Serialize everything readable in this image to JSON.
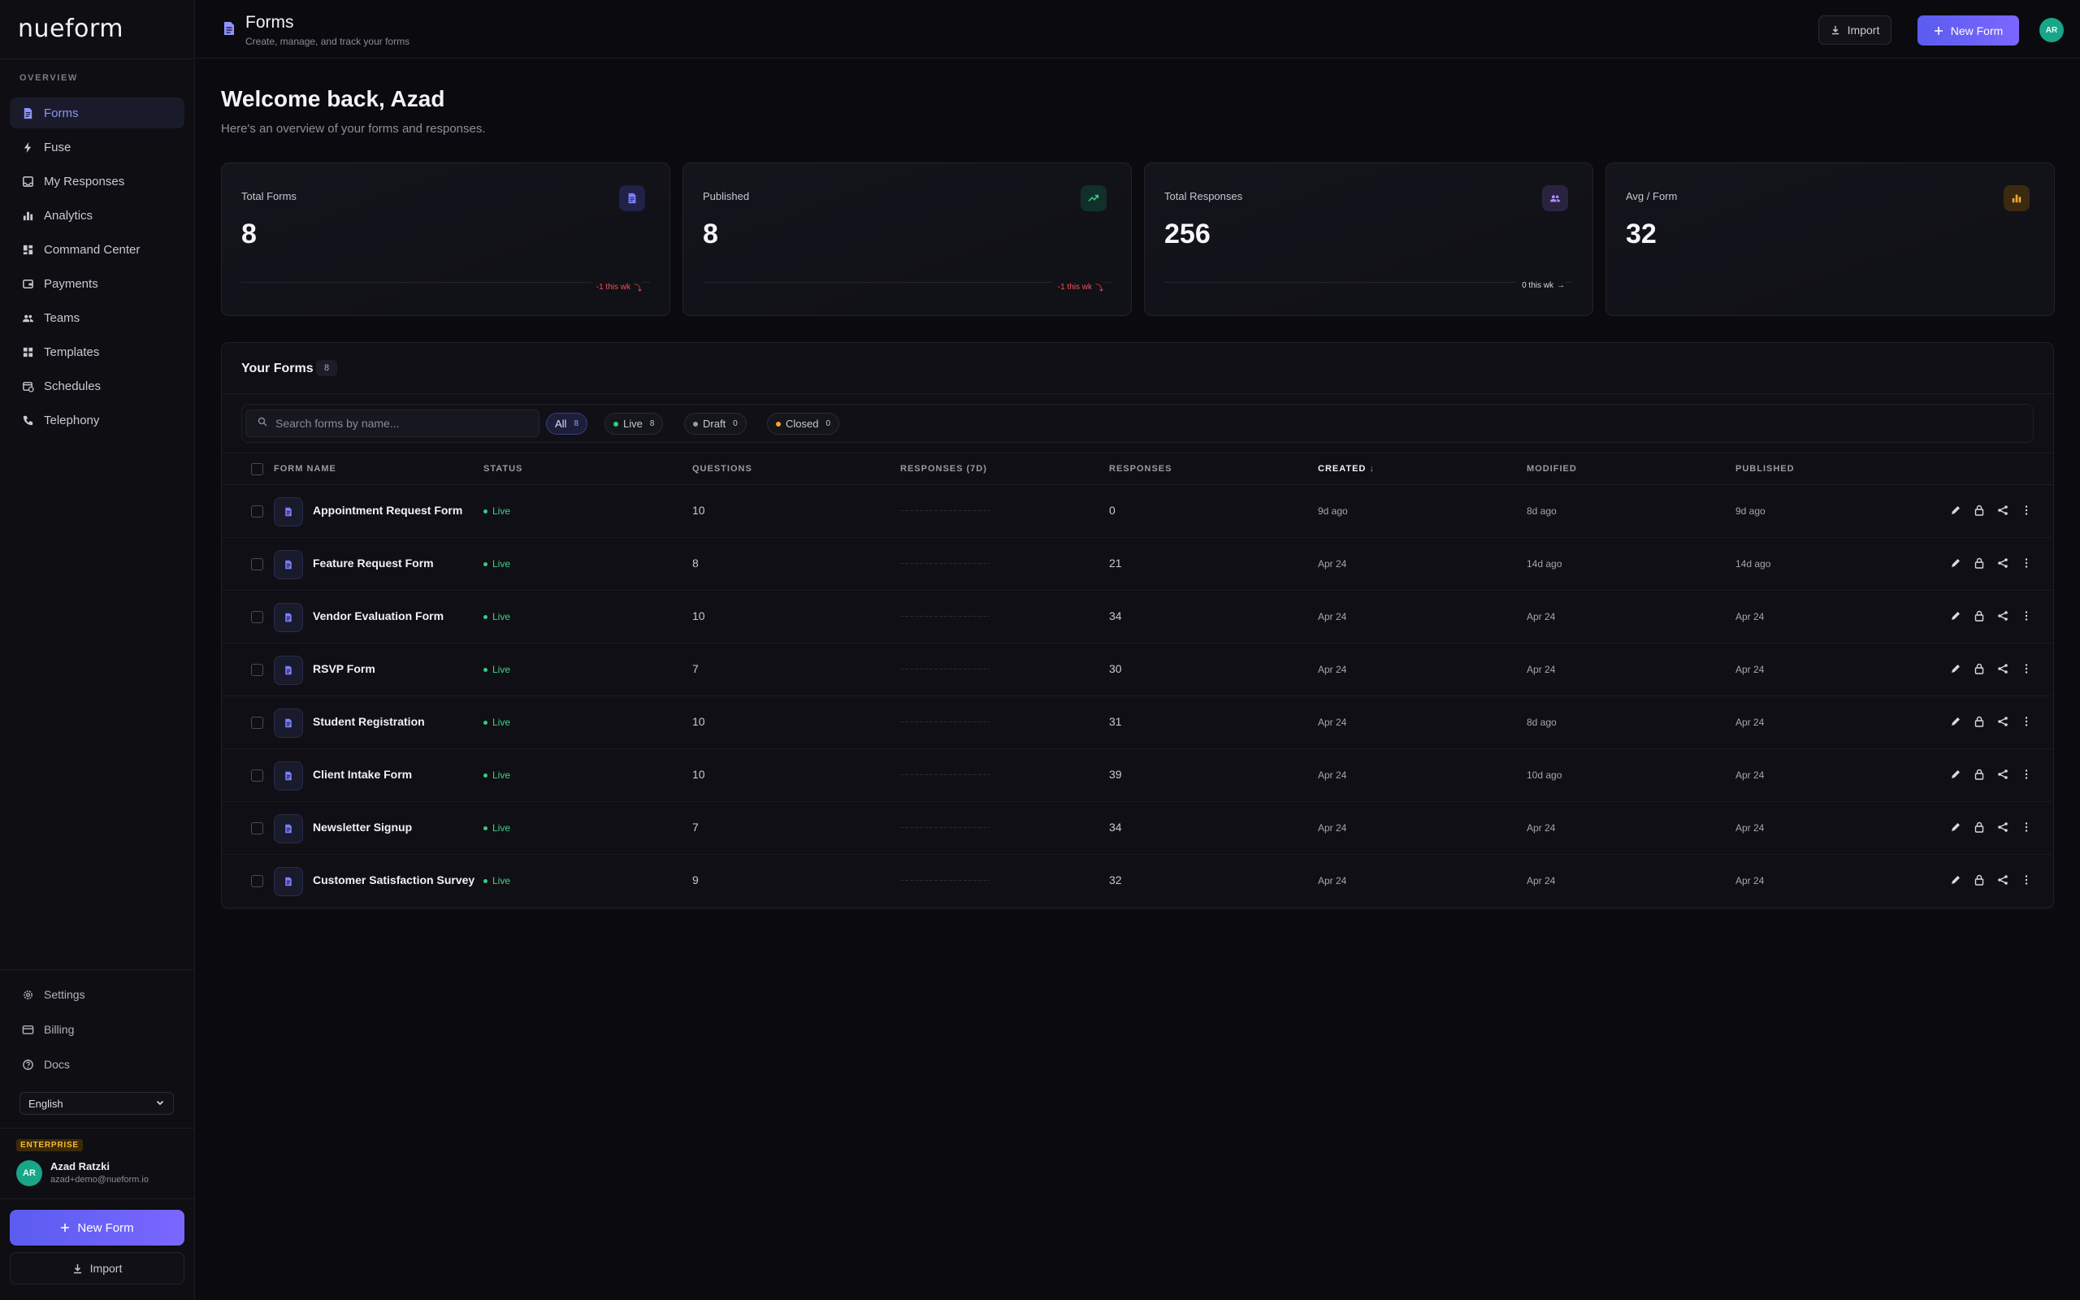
{
  "brand": {
    "logo_text": "nueform"
  },
  "sidebar": {
    "section_label": "OVERVIEW",
    "items": [
      {
        "label": "Forms",
        "icon": "document-icon",
        "active": true
      },
      {
        "label": "Fuse",
        "icon": "bolt-icon"
      },
      {
        "label": "My Responses",
        "icon": "inbox-icon"
      },
      {
        "label": "Analytics",
        "icon": "bar-chart-icon"
      },
      {
        "label": "Command Center",
        "icon": "dashboard-icon"
      },
      {
        "label": "Payments",
        "icon": "wallet-icon"
      },
      {
        "label": "Teams",
        "icon": "users-icon"
      },
      {
        "label": "Templates",
        "icon": "grid-icon"
      },
      {
        "label": "Schedules",
        "icon": "calendar-icon"
      },
      {
        "label": "Telephony",
        "icon": "phone-icon"
      }
    ],
    "bottom_items": [
      {
        "label": "Settings",
        "icon": "gear-icon"
      },
      {
        "label": "Billing",
        "icon": "credit-card-icon"
      },
      {
        "label": "Docs",
        "icon": "help-circle-icon"
      }
    ],
    "language": "English",
    "plan_badge": "ENTERPRISE",
    "user": {
      "initials": "AR",
      "name": "Azad Ratzki",
      "email": "azad+demo@nueform.io"
    },
    "new_form_label": "New Form",
    "import_label": "Import"
  },
  "header": {
    "title": "Forms",
    "subtitle": "Create, manage, and track your forms",
    "import_label": "Import",
    "new_form_label": "New Form",
    "avatar_initials": "AR"
  },
  "welcome": {
    "title": "Welcome back, Azad",
    "subtitle": "Here's an overview of your forms and responses."
  },
  "stats": [
    {
      "label": "Total Forms",
      "value": "8",
      "trend": "-1 this wk",
      "trend_dir": "down",
      "icon": "document-icon",
      "color": "#7c7fff"
    },
    {
      "label": "Published",
      "value": "8",
      "trend": "-1 this wk",
      "trend_dir": "down",
      "icon": "trending-up-icon",
      "color": "#2fcf7f"
    },
    {
      "label": "Total Responses",
      "value": "256",
      "trend": "0 this wk",
      "trend_dir": "flat",
      "icon": "users-icon",
      "color": "#b08cff"
    },
    {
      "label": "Avg / Form",
      "value": "32",
      "trend": "",
      "trend_dir": "none",
      "icon": "bar-chart-icon",
      "color": "#f4a62a"
    }
  ],
  "forms_panel": {
    "title": "Your Forms",
    "count": "8",
    "search_placeholder": "Search forms by name...",
    "filters": [
      {
        "label": "All",
        "count": "8",
        "active": true,
        "dot": ""
      },
      {
        "label": "Live",
        "count": "8",
        "dot": "#2fcf7f"
      },
      {
        "label": "Draft",
        "count": "0",
        "dot": "#9a9aa6"
      },
      {
        "label": "Closed",
        "count": "0",
        "dot": "#f4a62a"
      }
    ],
    "columns": [
      "FORM NAME",
      "STATUS",
      "QUESTIONS",
      "RESPONSES (7D)",
      "RESPONSES",
      "CREATED",
      "MODIFIED",
      "PUBLISHED"
    ],
    "sorted_column": "CREATED",
    "rows": [
      {
        "name": "Appointment Request Form",
        "status": "Live",
        "questions": "10",
        "responses": "0",
        "created": "9d ago",
        "modified": "8d ago",
        "published": "9d ago"
      },
      {
        "name": "Feature Request Form",
        "status": "Live",
        "questions": "8",
        "responses": "21",
        "created": "Apr 24",
        "modified": "14d ago",
        "published": "14d ago"
      },
      {
        "name": "Vendor Evaluation Form",
        "status": "Live",
        "questions": "10",
        "responses": "34",
        "created": "Apr 24",
        "modified": "Apr 24",
        "published": "Apr 24"
      },
      {
        "name": "RSVP Form",
        "status": "Live",
        "questions": "7",
        "responses": "30",
        "created": "Apr 24",
        "modified": "Apr 24",
        "published": "Apr 24"
      },
      {
        "name": "Student Registration",
        "status": "Live",
        "questions": "10",
        "responses": "31",
        "created": "Apr 24",
        "modified": "8d ago",
        "published": "Apr 24"
      },
      {
        "name": "Client Intake Form",
        "status": "Live",
        "questions": "10",
        "responses": "39",
        "created": "Apr 24",
        "modified": "10d ago",
        "published": "Apr 24"
      },
      {
        "name": "Newsletter Signup",
        "status": "Live",
        "questions": "7",
        "responses": "34",
        "created": "Apr 24",
        "modified": "Apr 24",
        "published": "Apr 24"
      },
      {
        "name": "Customer Satisfaction Survey",
        "status": "Live",
        "questions": "9",
        "responses": "32",
        "created": "Apr 24",
        "modified": "Apr 24",
        "published": "Apr 24"
      }
    ],
    "row_actions": [
      "edit-icon",
      "lock-icon",
      "share-icon",
      "more-vertical-icon"
    ]
  }
}
